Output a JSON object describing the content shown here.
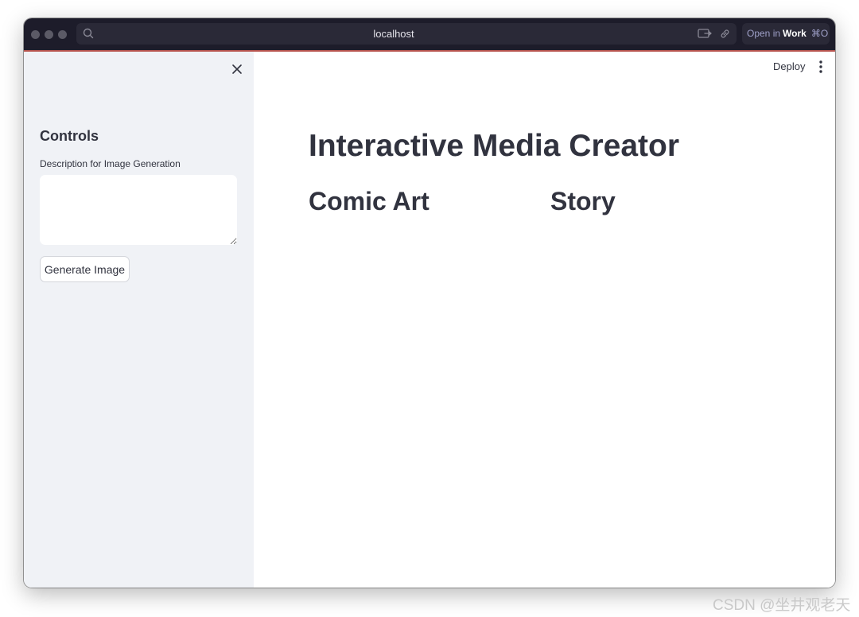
{
  "browser": {
    "url": "localhost",
    "open_in_prefix": "Open in",
    "open_in_app": "Work",
    "open_in_shortcut": "⌘O"
  },
  "sidebar": {
    "title": "Controls",
    "description_label": "Description for Image Generation",
    "description_value": "",
    "generate_button": "Generate Image"
  },
  "header": {
    "deploy_label": "Deploy"
  },
  "main": {
    "title": "Interactive Media Creator",
    "columns": [
      "Comic Art",
      "Story"
    ]
  },
  "watermark": "CSDN @坐井观老天",
  "colors": {
    "titlebar": "#1d1c2a",
    "sidebar_bg": "#f0f2f6",
    "text": "#31333f",
    "accent_line": "#b8554f"
  }
}
